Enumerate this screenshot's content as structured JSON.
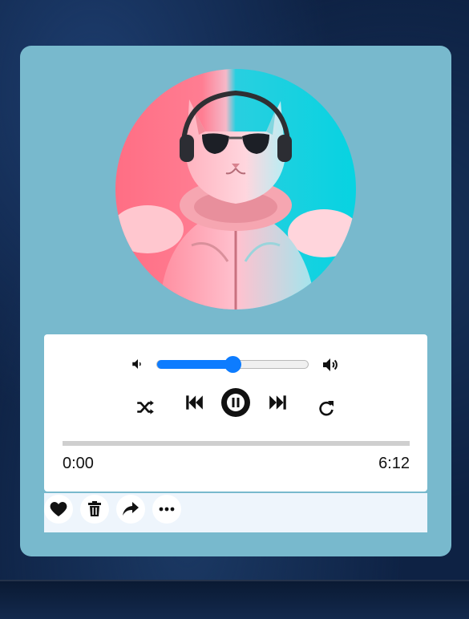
{
  "player": {
    "volume": 0.5,
    "progress": 0,
    "current_time": "0:00",
    "duration": "6:12"
  },
  "colors": {
    "accent": "#0d7cff",
    "card": "#78b9cd",
    "player_bg": "#ffffff",
    "action_bar_bg": "#eef5fc"
  },
  "icons": {
    "volume_low": "volume-low-icon",
    "volume_high": "volume-high-icon",
    "shuffle": "shuffle-icon",
    "previous": "skip-previous-icon",
    "pause": "pause-icon",
    "next": "skip-next-icon",
    "repeat": "repeat-icon",
    "like": "heart-icon",
    "delete": "trash-icon",
    "share": "share-icon",
    "more": "more-icon"
  }
}
